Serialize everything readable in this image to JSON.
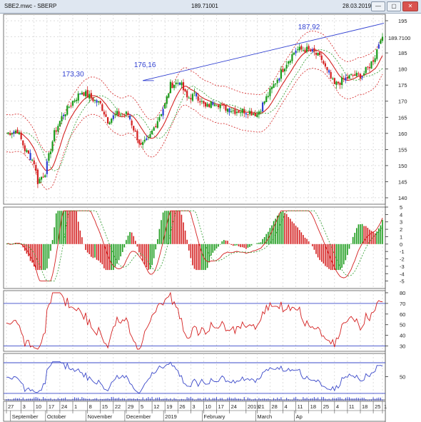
{
  "window": {
    "title": "SBE2.mwc - SBERP",
    "price": "189.71001",
    "date": "28.03.2019",
    "controls": [
      "—",
      "▢",
      "✕"
    ]
  },
  "price_axis": [
    "195",
    "190",
    "185",
    "180",
    "175",
    "170",
    "165",
    "160",
    "155",
    "150",
    "145",
    "140"
  ],
  "price_tag": "189.7100",
  "macd_axis": [
    "5",
    "4",
    "3",
    "2",
    "1",
    "0",
    "-1",
    "-2",
    "-3",
    "-4",
    "-5"
  ],
  "rsi_axis": [
    "80",
    "70",
    "60",
    "50",
    "40",
    "30"
  ],
  "stoch_axis": [
    "50"
  ],
  "annotations": [
    "173,30",
    "176,16",
    "187,92"
  ],
  "day_ticks": [
    "27",
    "3",
    "10",
    "17",
    "24",
    "1",
    "8",
    "15",
    "22",
    "29",
    "5",
    "12",
    "19",
    "26",
    "3",
    "10",
    "17",
    "24",
    "2019",
    "21",
    "28",
    "4",
    "11",
    "18",
    "25",
    "4",
    "11",
    "18",
    "25",
    "1"
  ],
  "month_labels": [
    "September",
    "October",
    "November",
    "December",
    "2019",
    "February",
    "March",
    "Ap"
  ],
  "colors": {
    "up": "#1a9a1a",
    "down": "#d42020",
    "neutral": "#2f3fd1",
    "band": "#d42020",
    "ma": "#d42020",
    "signal": "#2a9a2a"
  },
  "chart_data": [
    {
      "type": "candlestick",
      "title": "SBERP",
      "ylim": [
        138,
        197
      ],
      "annotations": [
        {
          "label": "173,30",
          "value": 173.3
        },
        {
          "label": "176,16",
          "value": 176.16
        },
        {
          "label": "187,92",
          "value": 187.92
        }
      ]
    },
    {
      "type": "histogram",
      "ylim": [
        -6,
        5
      ]
    },
    {
      "type": "line",
      "ylim": [
        25,
        82
      ],
      "levels": [
        70,
        30
      ]
    },
    {
      "type": "line",
      "ylim": [
        0,
        100
      ],
      "levels": [
        50
      ]
    }
  ]
}
